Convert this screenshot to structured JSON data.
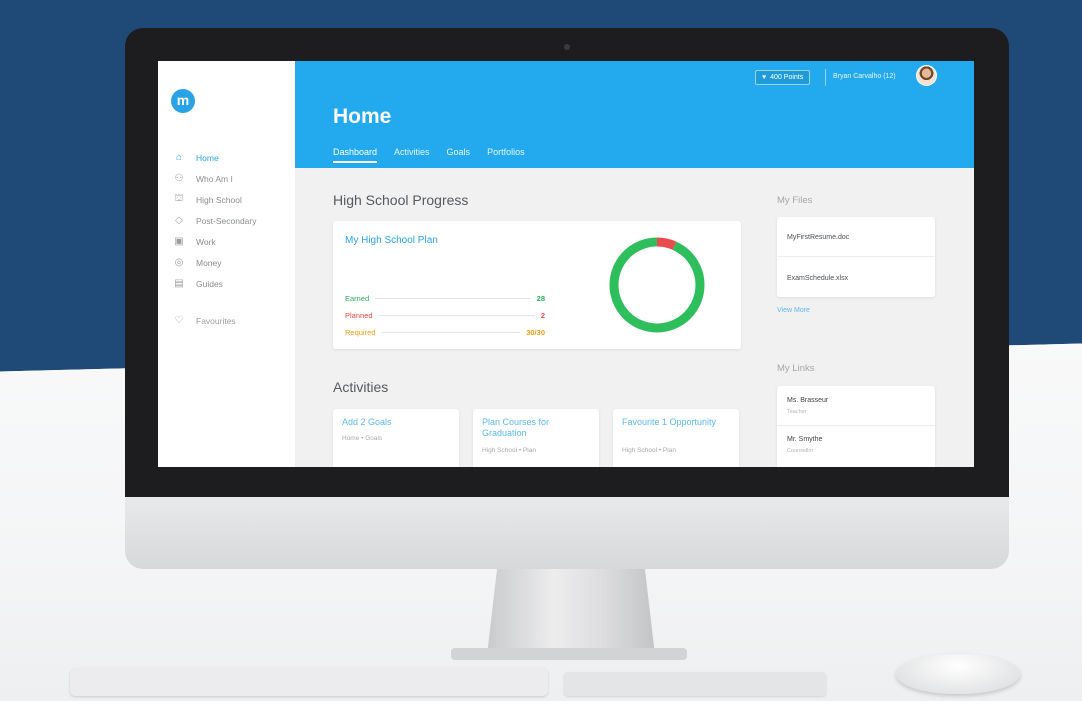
{
  "app": {
    "logo_letter": "m",
    "page_title": "Home",
    "points_label": "400 Points",
    "user_name": "Bryan Carvalho (12)"
  },
  "tabs": [
    {
      "label": "Dashboard",
      "active": true
    },
    {
      "label": "Activities",
      "active": false
    },
    {
      "label": "Goals",
      "active": false
    },
    {
      "label": "Portfolios",
      "active": false
    }
  ],
  "sidebar": {
    "items": [
      {
        "label": "Home",
        "icon": "home-icon",
        "active": true
      },
      {
        "label": "Who Am I",
        "icon": "people-icon",
        "active": false
      },
      {
        "label": "High School",
        "icon": "school-icon",
        "active": false
      },
      {
        "label": "Post-Secondary",
        "icon": "graduation-cap-icon",
        "active": false
      },
      {
        "label": "Work",
        "icon": "briefcase-icon",
        "active": false
      },
      {
        "label": "Money",
        "icon": "money-bag-icon",
        "active": false
      },
      {
        "label": "Guides",
        "icon": "guide-book-icon",
        "active": false
      }
    ],
    "favourites_label": "Favourites"
  },
  "progress": {
    "section_title": "High School Progress",
    "card_title": "My High School Plan",
    "rows": [
      {
        "label": "Earned",
        "value": "28",
        "color": "#27ae60"
      },
      {
        "label": "Planned",
        "value": "2",
        "color": "#e74c3c"
      },
      {
        "label": "Required",
        "value": "30/30",
        "color": "#f39c12"
      }
    ],
    "chart": {
      "earned": 28,
      "planned": 2,
      "required": 30,
      "earned_color": "#2ebf5c",
      "planned_color": "#e84c4f"
    }
  },
  "activities": {
    "section_title": "Activities",
    "cards": [
      {
        "title": "Add 2 Goals",
        "subtitle": "Home • Goals"
      },
      {
        "title": "Plan Courses for Graduation",
        "subtitle": "High School • Plan"
      },
      {
        "title": "Favourite 1 Opportunity",
        "subtitle": "High School • Plan"
      }
    ]
  },
  "files": {
    "title": "My Files",
    "items": [
      "MyFirstResume.doc",
      "ExamSchedule.xlsx"
    ],
    "view_more": "View More"
  },
  "links": {
    "title": "My Links",
    "items": [
      {
        "name": "Ms. Brasseur",
        "role": "Teacher"
      },
      {
        "name": "Mr. Smythe",
        "role": "Counsellor"
      }
    ]
  },
  "colors": {
    "accent": "#23a9ed",
    "background_navy": "#1f4a78"
  }
}
